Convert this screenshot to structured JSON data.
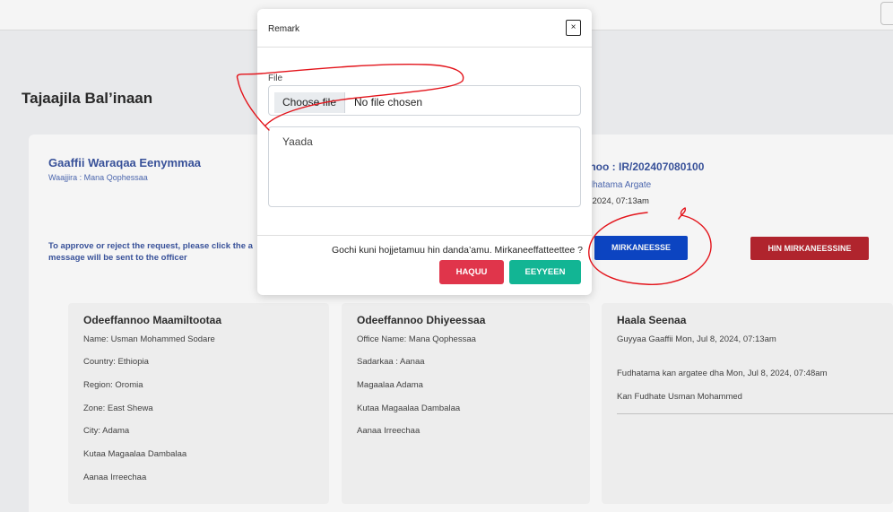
{
  "page": {
    "title": "Tajaajila Bal’inaan"
  },
  "request": {
    "title": "Gaaffii Waraqaa Eenymmaa",
    "subtitle": "Waajjira : Mana Qophessaa",
    "id_text": "nnoo : IR/202407080100",
    "status_text": "udhatama Argate",
    "date_text": "8, 2024, 07:13am",
    "instruction": "To approve or reject the request, please click the a message will be sent to the officer",
    "approve_label": "MIRKANEESSE",
    "reject_label": "HIN MIRKANEESSINE"
  },
  "cards": {
    "customer": {
      "title": "Odeeffannoo Maamiltootaa",
      "lines": [
        "Name: Usman Mohammed Sodare",
        "Country: Ethiopia",
        "Region: Oromia",
        "Zone: East Shewa",
        "City: Adama",
        "Kutaa Magaalaa Dambalaa",
        "Aanaa Irreechaa"
      ]
    },
    "service": {
      "title": "Odeeffannoo Dhiyeessaa",
      "lines": [
        "Office Name: Mana Qophessaa",
        "Sadarkaa : Aanaa",
        "Magaalaa Adama",
        "Kutaa Magaalaa Dambalaa",
        "Aanaa Irreechaa"
      ]
    },
    "status": {
      "title": "Haala Seenaa",
      "lines": [
        "Guyyaa Gaaffii Mon, Jul 8, 2024, 07:13am",
        "Fudhatama kan argatee dha Mon, Jul 8, 2024, 07:48am",
        "Kan Fudhate Usman Mohammed"
      ]
    }
  },
  "modal": {
    "title": "Remark",
    "close_label": "×",
    "file_label": "File",
    "choose_file_label": "Choose file",
    "no_file_label": "No file chosen",
    "remark_value": "Yaada",
    "confirm_text": "Gochi kuni hojjetamuu hin danda’amu. Mirkaneeffatteettee ?",
    "no_label": "HAQUU",
    "yes_label": "EEYYEEN"
  },
  "colors": {
    "accent_blue": "#3b55a0",
    "approve": "#0d47c9",
    "reject": "#b8262f",
    "no": "#e0354b",
    "yes": "#12b594",
    "annotation": "#e3141b"
  }
}
